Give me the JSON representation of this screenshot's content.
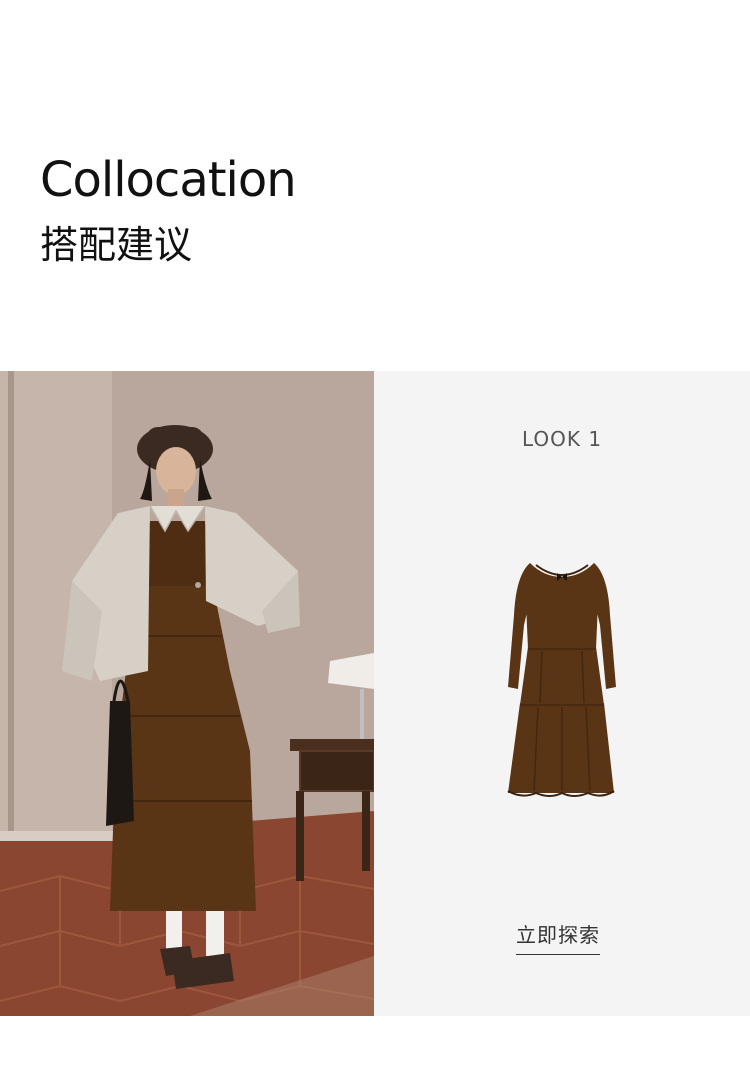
{
  "header": {
    "title_en": "Collocation",
    "title_cn": "搭配建议"
  },
  "look": {
    "label": "LOOK 1",
    "explore_label": "立即探索"
  },
  "colors": {
    "background": "#ffffff",
    "panel": "#f4f4f4",
    "dress": "#5a3515",
    "text": "#111111"
  },
  "icons": {
    "model_photo": "model-outfit-photo",
    "product_image": "brown-dress-image"
  }
}
